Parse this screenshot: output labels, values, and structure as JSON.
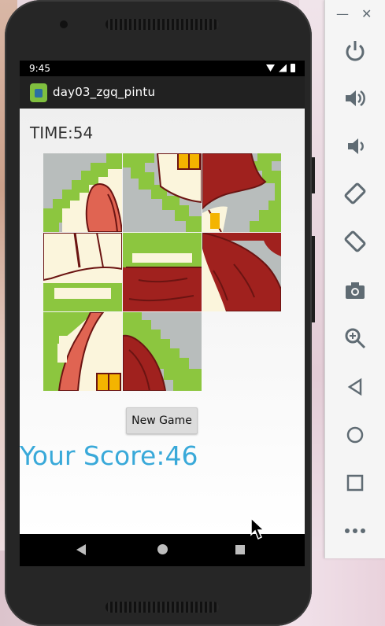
{
  "status_bar": {
    "time": "9:45"
  },
  "app": {
    "title": "day03_zgq_pintu",
    "time_label": "TIME:54",
    "new_game_label": "New Game",
    "score_label": "Your Score:46"
  },
  "puzzle": {
    "rows": 3,
    "cols": 3,
    "tiles": [
      {
        "position": 1,
        "piece": "roof-left-eave"
      },
      {
        "position": 2,
        "piece": "window-top-center"
      },
      {
        "position": 3,
        "piece": "roof-right-top"
      },
      {
        "position": 4,
        "piece": "wall-left-middle"
      },
      {
        "position": 5,
        "piece": "roof-center-lower"
      },
      {
        "position": 6,
        "piece": "roof-right-lower"
      },
      {
        "position": 7,
        "piece": "house-bottom-left"
      },
      {
        "position": 8,
        "piece": "roof-edge-bottom"
      },
      {
        "position": 9,
        "piece": "empty"
      }
    ]
  },
  "emulator_toolbar": {
    "window_controls": [
      "minimize-icon",
      "close-icon"
    ],
    "tools": [
      "power-icon",
      "volume-up-icon",
      "volume-down-icon",
      "rotate-left-icon",
      "rotate-right-icon",
      "camera-icon",
      "zoom-icon",
      "back-icon",
      "home-icon",
      "overview-icon",
      "more-icon"
    ]
  },
  "colors": {
    "grass": "#8cc63f",
    "roof": "#a0211e",
    "roof_light": "#e06452",
    "wall": "#fbf5dc",
    "window": "#f4b400",
    "sky": "#b8bdbc",
    "score": "#39a9d9"
  }
}
